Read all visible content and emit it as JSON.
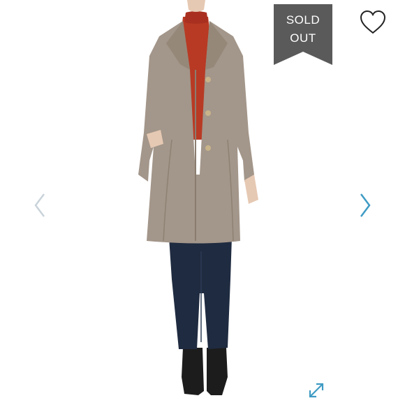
{
  "product": {
    "status_badge": {
      "line1": "SOLD",
      "line2": "OUT",
      "color": "#5a5a5a"
    }
  },
  "gallery": {
    "main_image": "coat-photo",
    "icons": {
      "favorite": "heart-outline-icon",
      "previous": "chevron-left-icon",
      "next": "chevron-right-icon",
      "fullscreen": "expand-icon"
    },
    "colors": {
      "accent": "#3f9bc4",
      "inactive_arrow": "#c9d3da",
      "coat": "#a3968a",
      "sweater": "#b83a24",
      "jeans": "#1f2b40",
      "boots": "#1c1c1c"
    }
  }
}
